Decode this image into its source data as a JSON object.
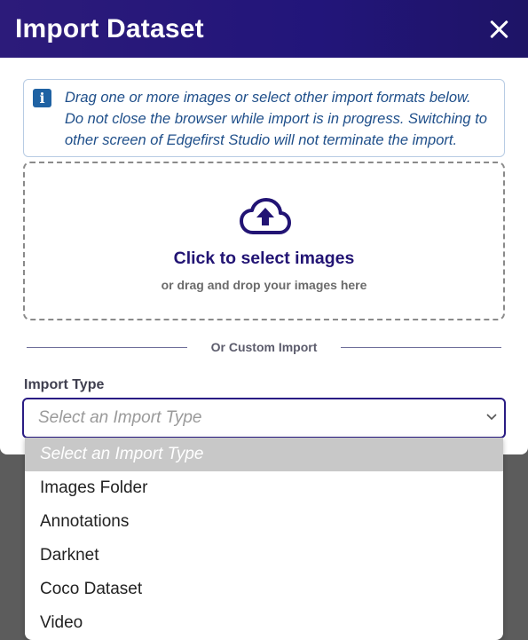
{
  "modal": {
    "title": "Import Dataset",
    "close_icon": "close-icon"
  },
  "info": {
    "icon": "info-icon",
    "icon_glyph": "i",
    "text": "Drag one or more images or select other import formats below. Do not close the browser while import is in progress. Switching to other screen of Edgefirst Studio will not terminate the import."
  },
  "dropzone": {
    "icon": "cloud-upload-icon",
    "title": "Click to select images",
    "subtitle": "or drag and drop your images here"
  },
  "divider": {
    "label": "Or Custom Import"
  },
  "import_type": {
    "label": "Import Type",
    "value": "Select an Import Type",
    "options": [
      "Select an Import Type",
      "Images Folder",
      "Annotations",
      "Darknet",
      "Coco Dataset",
      "Video"
    ],
    "selected_index": 0
  },
  "colors": {
    "header": "#22157a",
    "accent": "#221474",
    "info_text": "#1f4f8a",
    "info_icon": "#1f62a3"
  }
}
